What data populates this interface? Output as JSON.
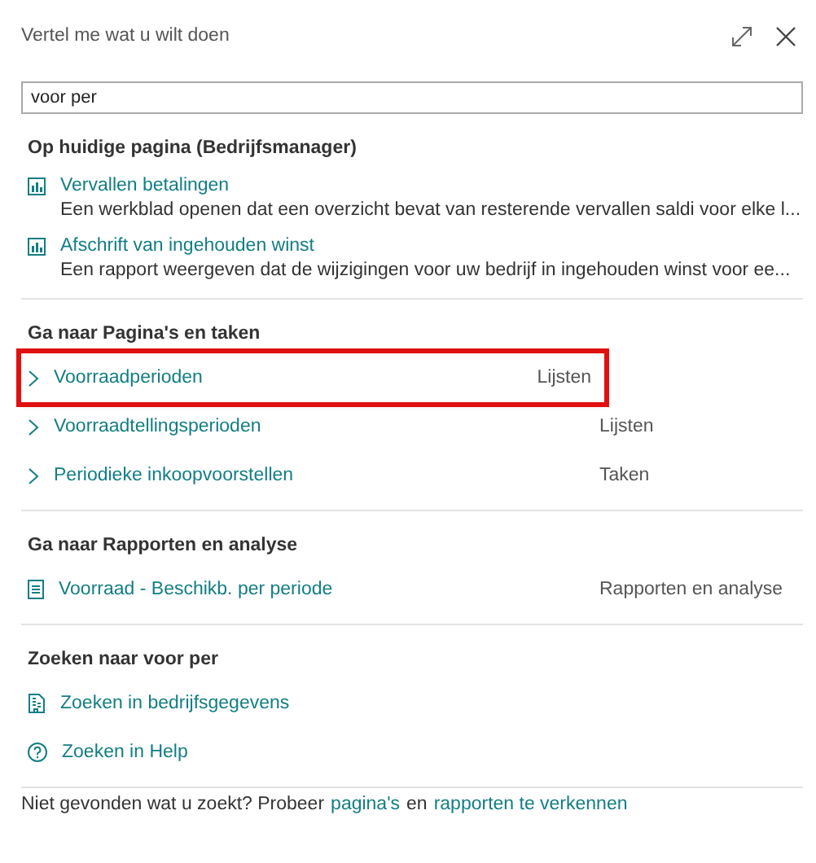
{
  "window": {
    "title": "Vertel me wat u wilt doen"
  },
  "search": {
    "value": "voor per"
  },
  "sections": [
    {
      "heading": "Op huidige pagina (Bedrijfsmanager)",
      "items": [
        {
          "kind": "report",
          "label": "Vervallen betalingen",
          "description": "Een werkblad openen dat een overzicht bevat van resterende vervallen saldi voor elke l..."
        },
        {
          "kind": "report",
          "label": "Afschrift van ingehouden winst",
          "description": "Een rapport weergeven dat de wijzigingen voor uw bedrijf in ingehouden winst voor ee..."
        }
      ]
    },
    {
      "heading": "Ga naar Pagina's en taken",
      "items": [
        {
          "kind": "page",
          "label": "Voorraadperioden",
          "category": "Lijsten",
          "highlighted": true
        },
        {
          "kind": "page",
          "label": "Voorraadtellingsperioden",
          "category": "Lijsten",
          "highlighted": false
        },
        {
          "kind": "page",
          "label": "Periodieke inkoopvoorstellen",
          "category": "Taken",
          "highlighted": false
        }
      ]
    },
    {
      "heading": "Ga naar Rapporten en analyse",
      "items": [
        {
          "kind": "list-report",
          "label": "Voorraad - Beschikb. per periode",
          "category": "Rapporten en analyse"
        }
      ]
    },
    {
      "heading": "Zoeken naar voor per",
      "items": [
        {
          "kind": "data",
          "label": "Zoeken in bedrijfsgegevens"
        },
        {
          "kind": "help",
          "label": "Zoeken in Help"
        }
      ]
    }
  ],
  "footer": [
    {
      "kind": "text",
      "text": "Niet gevonden wat u zoekt? Probeer"
    },
    {
      "kind": "link",
      "text": "pagina's"
    },
    {
      "kind": "text",
      "text": "en"
    },
    {
      "kind": "link",
      "text": "rapporten te verkennen"
    }
  ]
}
